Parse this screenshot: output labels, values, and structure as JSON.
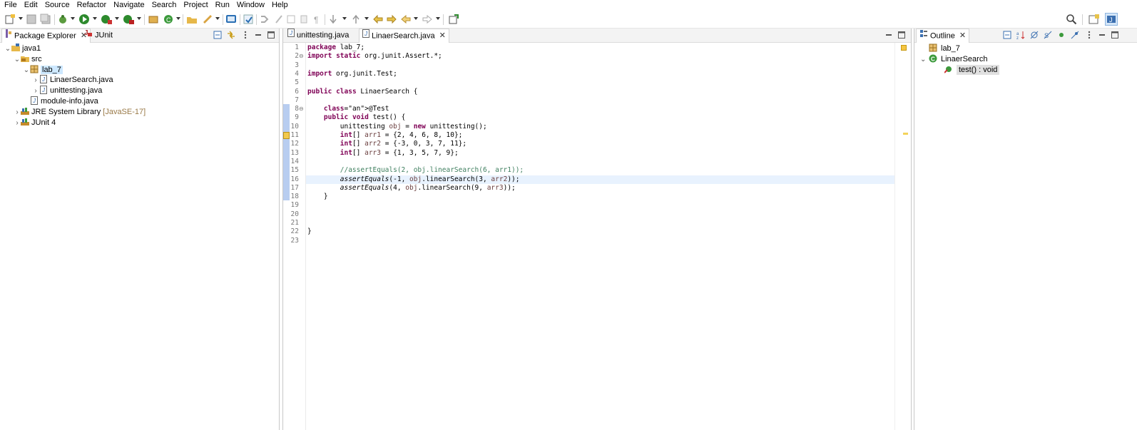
{
  "menu": [
    "File",
    "Edit",
    "Source",
    "Refactor",
    "Navigate",
    "Search",
    "Project",
    "Run",
    "Window",
    "Help"
  ],
  "left_panel": {
    "tabs": [
      {
        "label": "Package Explorer",
        "icon": "package-explorer-icon"
      },
      {
        "label": "JUnit",
        "icon": "junit-icon"
      }
    ],
    "tree": [
      {
        "label": "java1",
        "depth": 0,
        "expanded": true,
        "icon": "java-project-icon"
      },
      {
        "label": "src",
        "depth": 1,
        "expanded": true,
        "icon": "source-folder-icon"
      },
      {
        "label": "lab_7",
        "depth": 2,
        "expanded": true,
        "icon": "package-icon",
        "selected": true
      },
      {
        "label": "LinaerSearch.java",
        "depth": 3,
        "expanded": false,
        "icon": "java-file-icon"
      },
      {
        "label": "unittesting.java",
        "depth": 3,
        "expanded": false,
        "icon": "java-file-icon"
      },
      {
        "label": "module-info.java",
        "depth": 2,
        "expanded": null,
        "icon": "java-file-icon"
      },
      {
        "label": "JRE System Library",
        "decoration": "[JavaSE-17]",
        "depth": 1,
        "expanded": false,
        "icon": "library-icon"
      },
      {
        "label": "JUnit 4",
        "depth": 1,
        "expanded": false,
        "icon": "library-icon"
      }
    ]
  },
  "editor": {
    "tabs": [
      {
        "label": "unittesting.java",
        "active": false
      },
      {
        "label": "LinaerSearch.java",
        "active": true
      }
    ],
    "current_line": 16,
    "lines": [
      "package lab_7;",
      "import static org.junit.Assert.*;",
      "",
      "import org.junit.Test;",
      "",
      "public class LinaerSearch {",
      "",
      "    @Test",
      "    public void test() {",
      "        unittesting obj = new unittesting();",
      "        int[] arr1 = {2, 4, 6, 8, 10};",
      "        int[] arr2 = {-3, 0, 3, 7, 11};",
      "        int[] arr3 = {1, 3, 5, 7, 9};",
      "",
      "        //assertEquals(2, obj.linearSearch(6, arr1));",
      "        assertEquals(-1, obj.linearSearch(3, arr2));",
      "        assertEquals(4, obj.linearSearch(9, arr3));",
      "    }",
      "",
      "",
      "",
      "}",
      ""
    ]
  },
  "outline": {
    "tab": {
      "label": "Outline",
      "icon": "outline-icon"
    },
    "items": [
      {
        "label": "lab_7",
        "depth": 0,
        "icon": "package-icon"
      },
      {
        "label": "LinaerSearch",
        "depth": 0,
        "icon": "class-icon",
        "expanded": true
      },
      {
        "label": "test() : void",
        "depth": 1,
        "icon": "method-icon",
        "selected": true
      }
    ]
  }
}
